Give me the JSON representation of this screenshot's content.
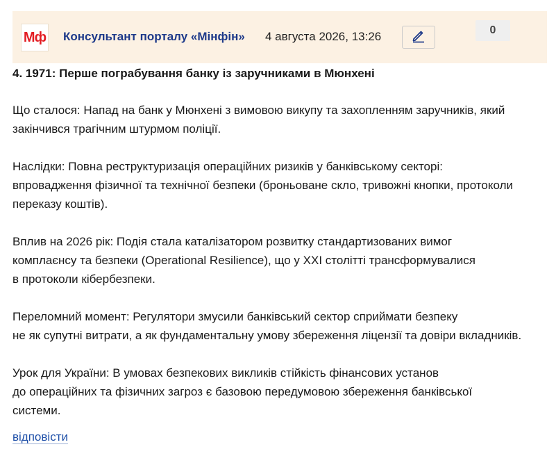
{
  "header": {
    "logo_text": "Мф",
    "author": "Консультант порталу «Мінфін»",
    "date": "4 августа 2026, 13:26",
    "edit_icon": "pencil-icon",
    "counter": "0"
  },
  "post": {
    "title": "4. 1971: Перше пограбування банку із заручниками в Мюнхені",
    "paragraphs": [
      [
        "Що сталося: Напад на банк у Мюнхені з вимовою викупу та захопленням заручників, який",
        "закінчився трагічним штурмом поліції."
      ],
      [
        "Наслідки: Повна реструктуризація операційних ризиків у банківському секторі:",
        "впровадження фізичної та технічної безпеки (броньоване скло, тривожні кнопки, протоколи",
        "переказу коштів)."
      ],
      [
        "Вплив на 2026 рік: Подія стала каталізатором розвитку стандартизованих вимог",
        "комплаєнсу та безпеки (Operational Resilience), що у XXI столітті трансформувалися",
        "в протоколи кібербезпеки."
      ],
      [
        "Переломний момент: Регулятори змусили банківський сектор сприймати безпеку",
        "не як супутні витрати, а як фундаментальну умову збереження ліцензії та довіри вкладників."
      ],
      [
        "Урок для України: В умовах безпекових викликів стійкість фінансових установ",
        "до операційних та фізичних загроз є базовою передумовою збереження банківської",
        "системи."
      ]
    ]
  },
  "reply_label": "відповісти",
  "colors": {
    "header_bg": "#fcf1e3",
    "author": "#1e3a8a",
    "logo": "#e31e24",
    "link": "#1e4fa8"
  }
}
